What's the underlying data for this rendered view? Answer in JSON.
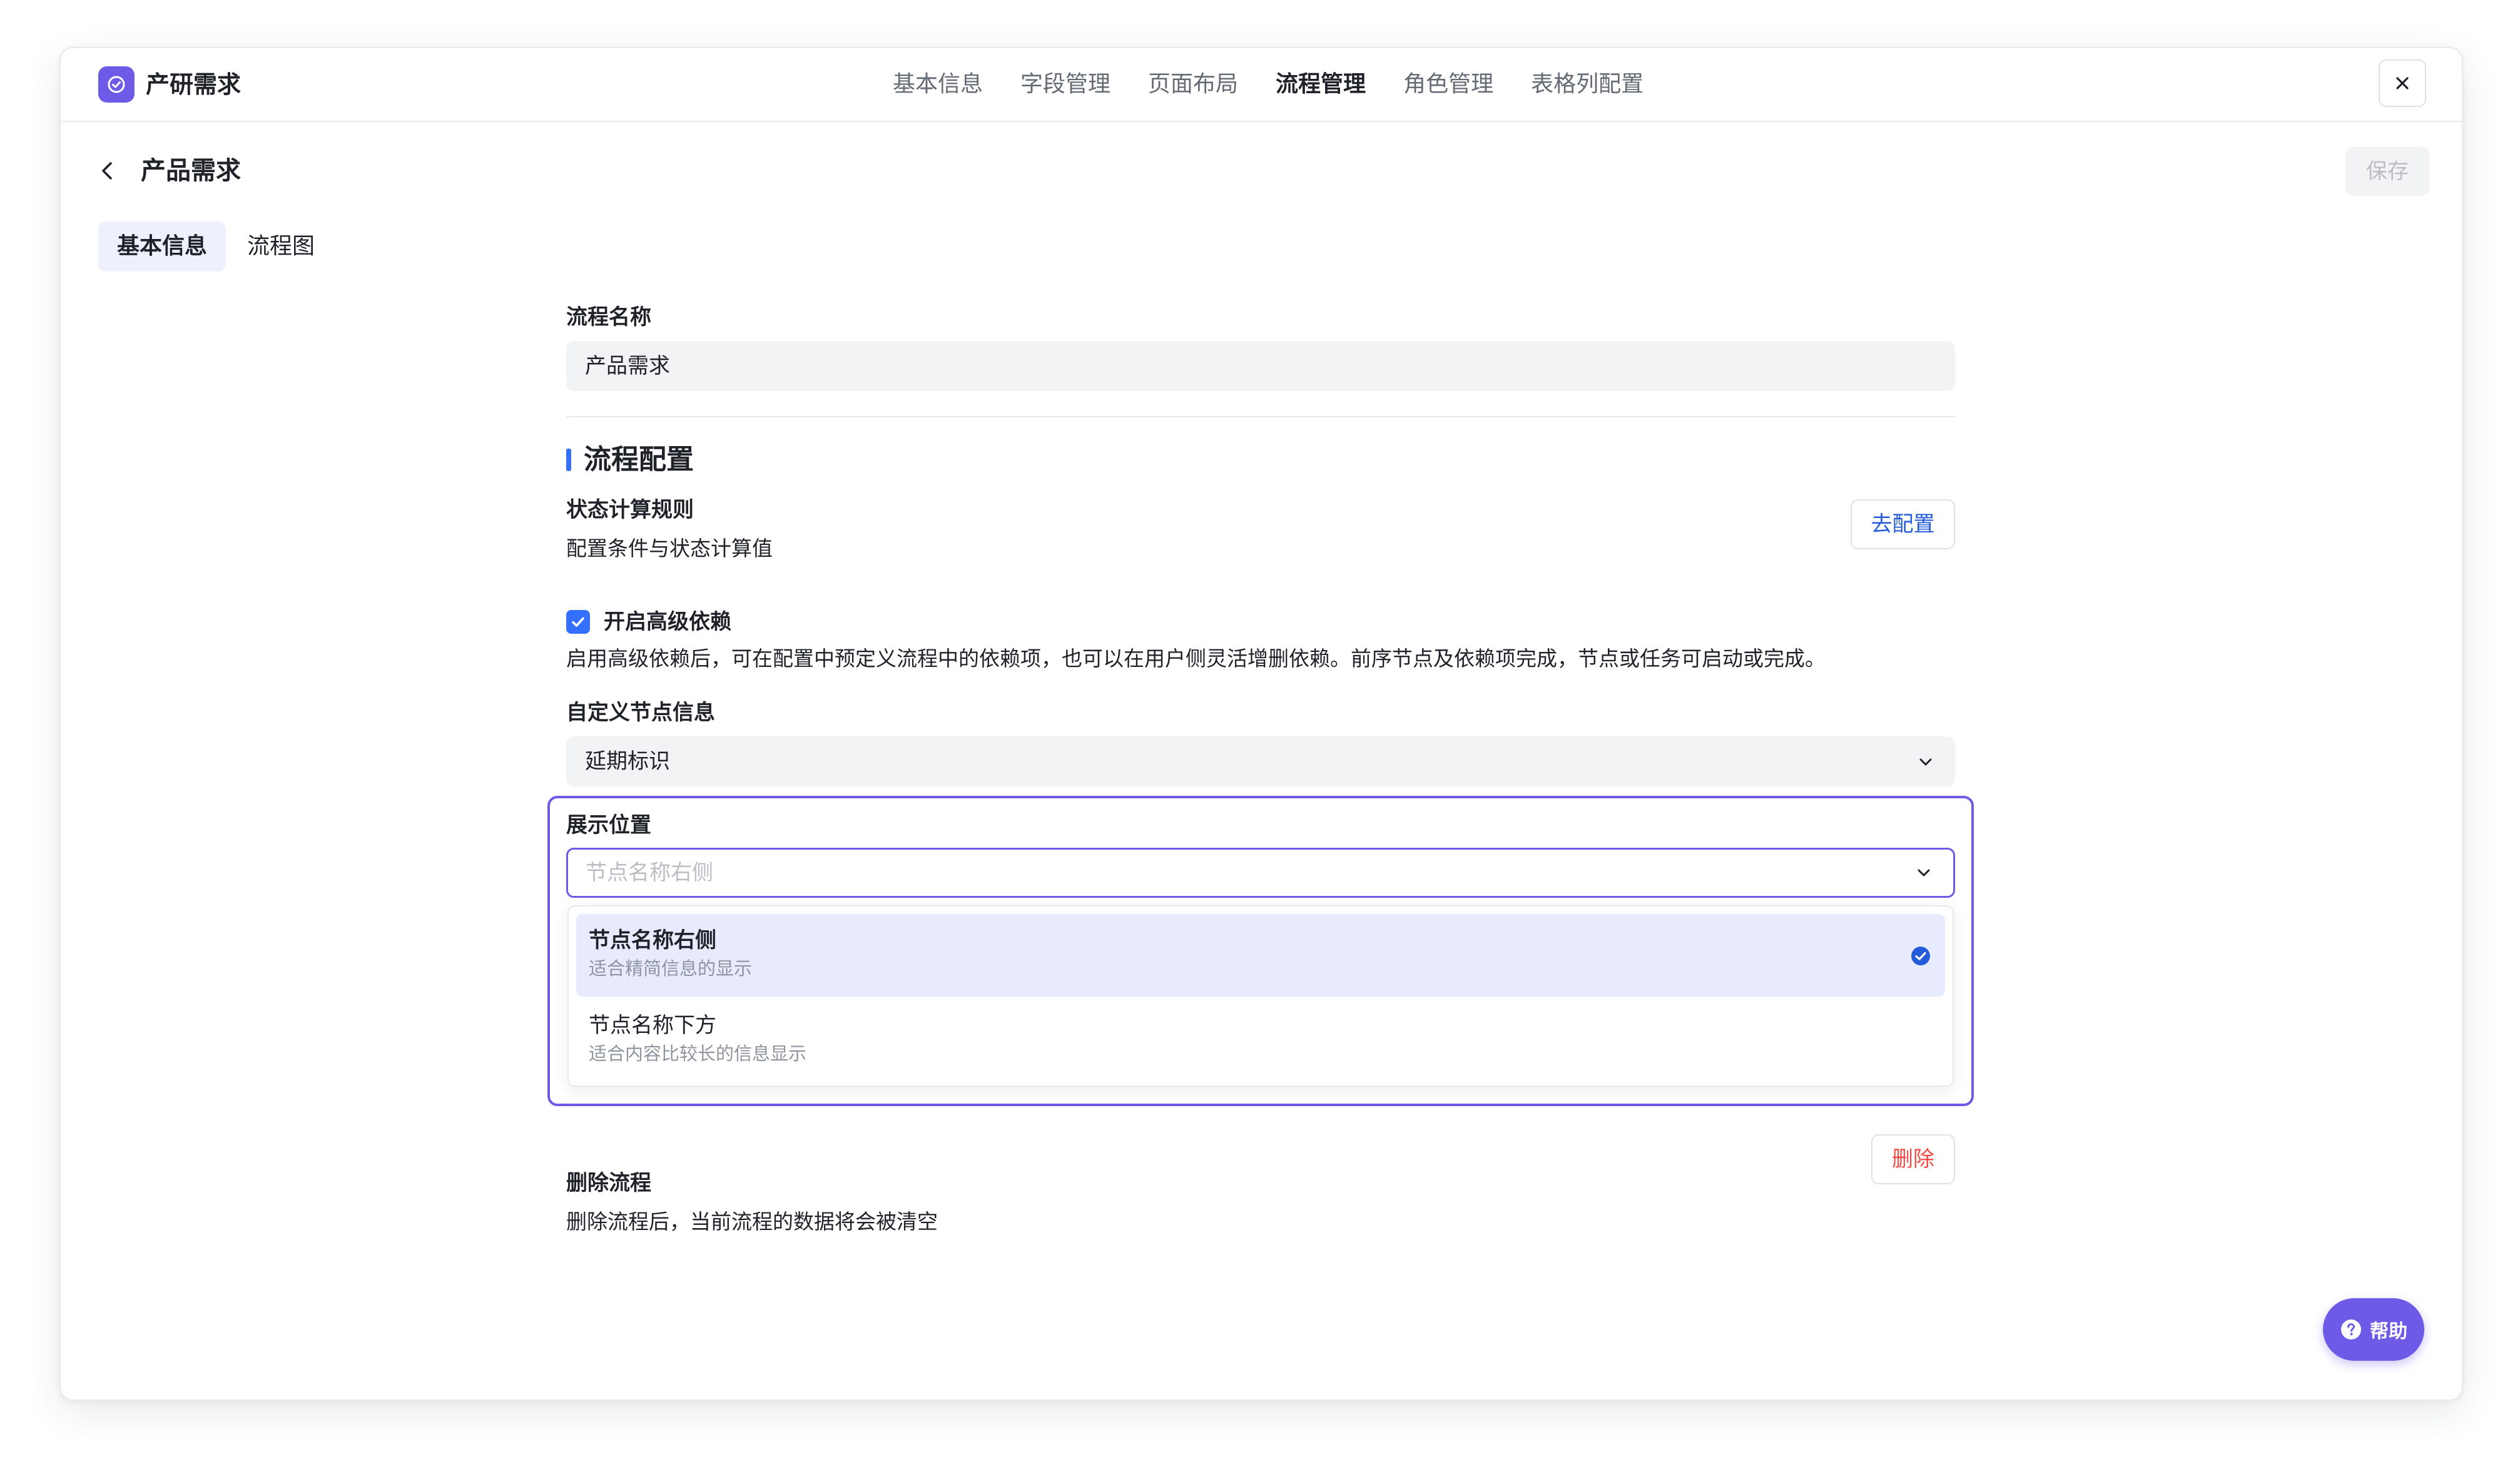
{
  "app": {
    "title": "产研需求"
  },
  "nav": [
    "基本信息",
    "字段管理",
    "页面布局",
    "流程管理",
    "角色管理",
    "表格列配置"
  ],
  "header": {
    "title": "产品需求",
    "save_label": "保存"
  },
  "tabs": [
    "基本信息",
    "流程图"
  ],
  "form": {
    "flow_name_label": "流程名称",
    "flow_name_value": "产品需求",
    "section_title": "流程配置",
    "status_rule_label": "状态计算规则",
    "status_rule_desc": "配置条件与状态计算值",
    "config_button": "去配置",
    "advanced_dep_label": "开启高级依赖",
    "advanced_dep_checked": true,
    "advanced_dep_desc": "启用高级依赖后，可在配置中预定义流程中的依赖项，也可以在用户侧灵活增删依赖。前序节点及依赖项完成，节点或任务可启动或完成。",
    "custom_node_label": "自定义节点信息",
    "custom_node_value": "延期标识",
    "position_label": "展示位置",
    "position_placeholder": "节点名称右侧",
    "position_options": [
      {
        "title": "节点名称右侧",
        "desc": "适合精简信息的显示",
        "selected": true
      },
      {
        "title": "节点名称下方",
        "desc": "适合内容比较长的信息显示",
        "selected": false
      }
    ],
    "delete_label": "删除流程",
    "delete_desc": "删除流程后，当前流程的数据将会被清空",
    "delete_button": "删除"
  },
  "help": {
    "label": "帮助"
  },
  "colors": {
    "accent": "#6d5ae6",
    "primary": "#3370ff",
    "danger": "#f54a45"
  }
}
